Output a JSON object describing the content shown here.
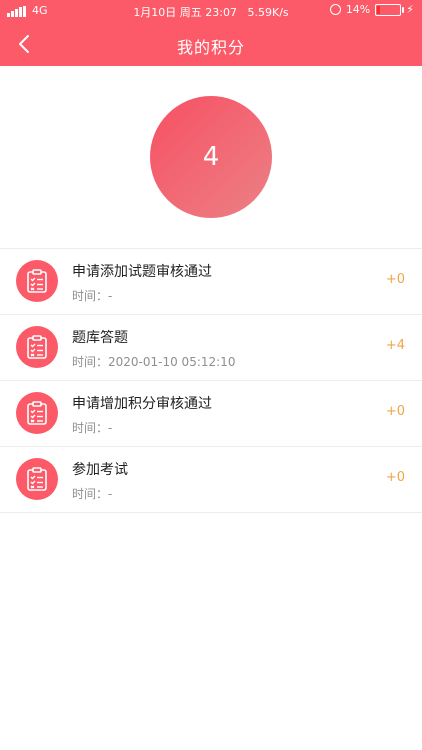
{
  "status_bar": {
    "network": "4G",
    "date_time": "1月10日 周五 23:07",
    "speed": "5.59K/s",
    "battery": "14%",
    "battery_level": 0.14
  },
  "header": {
    "title": "我的积分",
    "back_icon": "chevron-left-icon",
    "bg_color": "#fc5a68"
  },
  "score": {
    "value": "4"
  },
  "records": [
    {
      "title": "申请添加试题审核通过",
      "time": "时间：-",
      "points": "+0",
      "icon": "clipboard-checklist-icon"
    },
    {
      "title": "题库答题",
      "time": "时间：2020-01-10 05:12:10",
      "points": "+4",
      "icon": "clipboard-checklist-icon"
    },
    {
      "title": "申请增加积分审核通过",
      "time": "时间：-",
      "points": "+0",
      "icon": "clipboard-checklist-icon"
    },
    {
      "title": "参加考试",
      "time": "时间：-",
      "points": "+0",
      "icon": "clipboard-checklist-icon"
    }
  ]
}
